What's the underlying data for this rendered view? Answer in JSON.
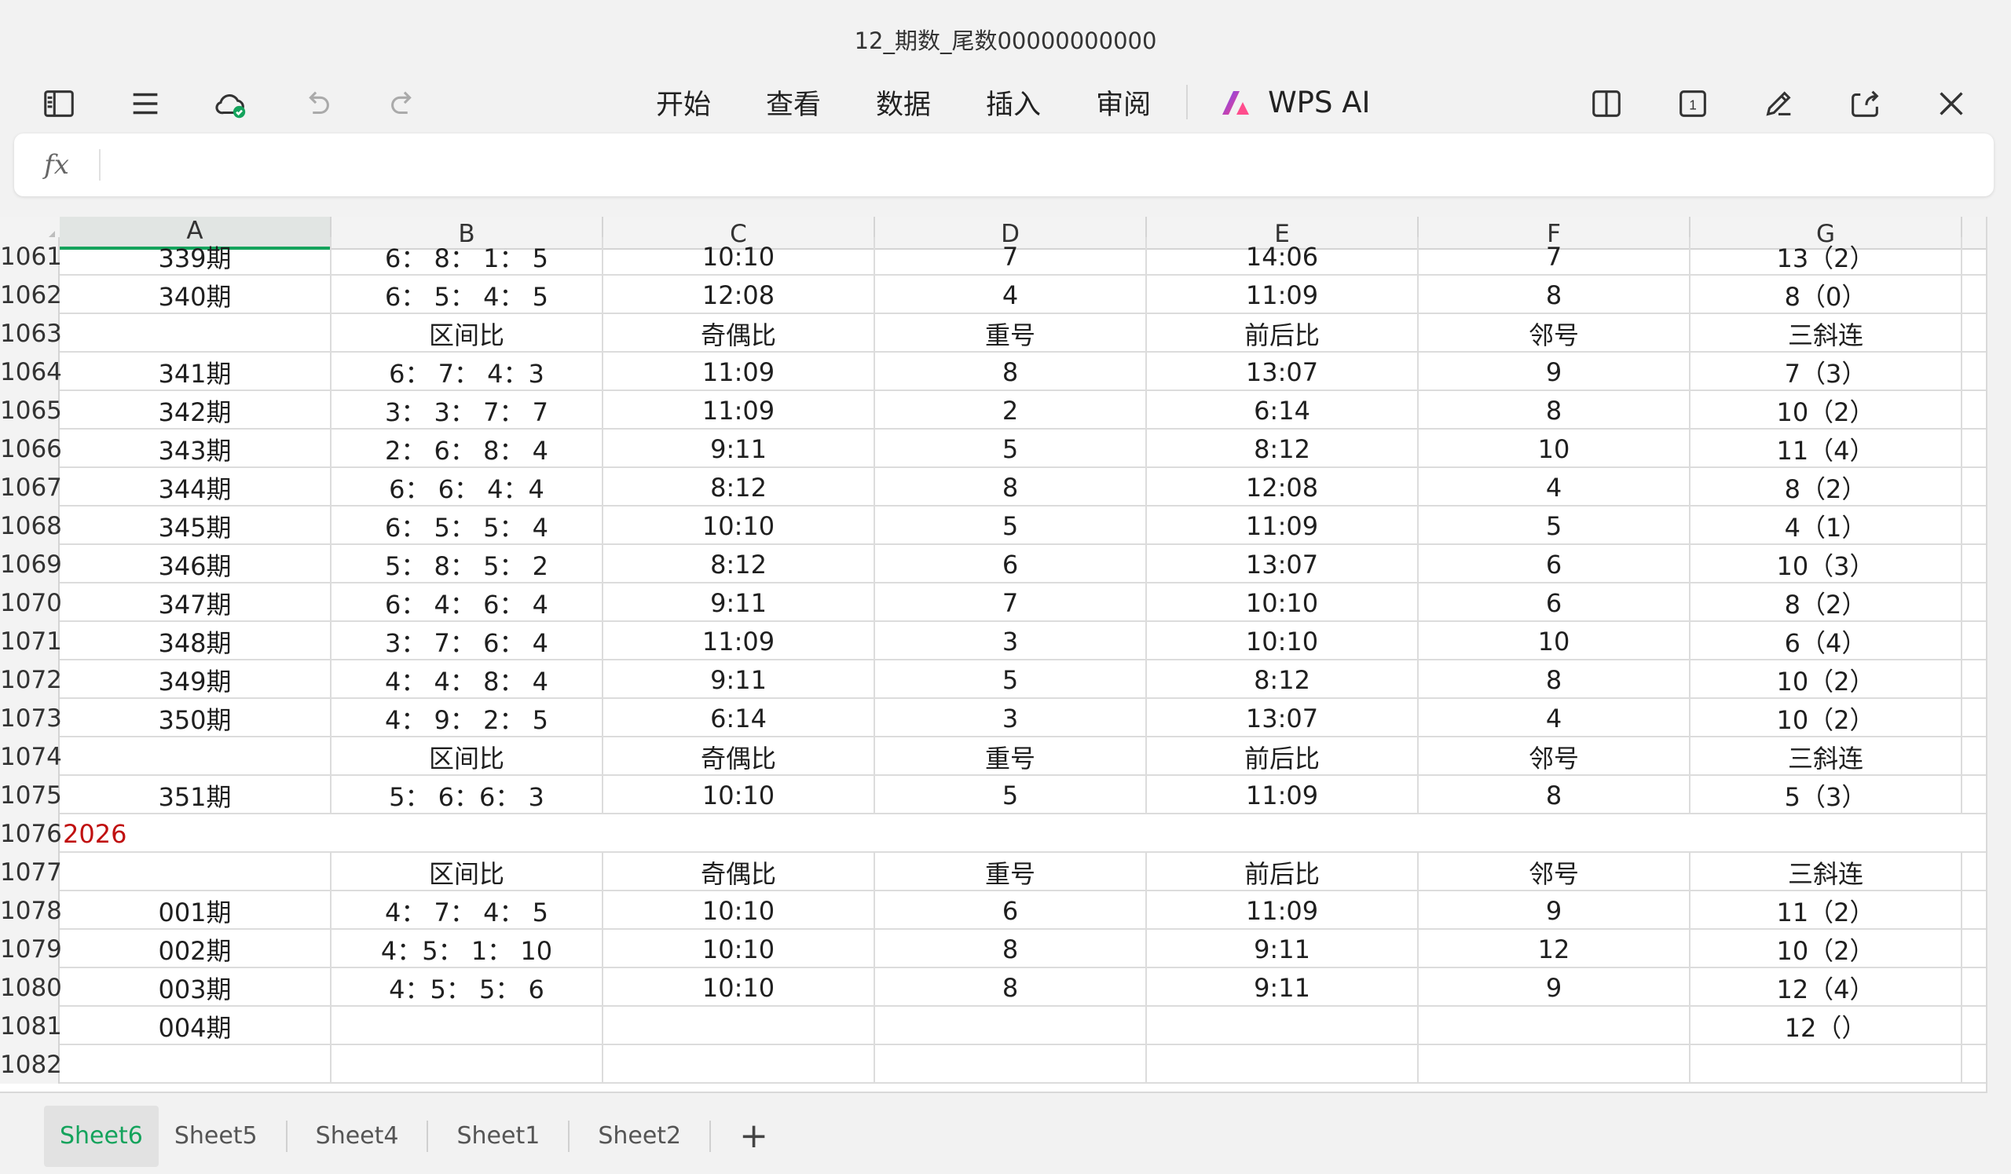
{
  "window": {
    "title": "12_期数_尾数00000000000"
  },
  "toolbar": {
    "menu": [
      "开始",
      "查看",
      "数据",
      "插入",
      "审阅"
    ],
    "ai_label": "WPS AI",
    "page_badge": "1"
  },
  "formula_bar": {
    "fx_label": "fx",
    "value": ""
  },
  "columns": [
    "A",
    "B",
    "C",
    "D",
    "E",
    "F",
    "G"
  ],
  "rows": [
    {
      "n": "1061",
      "cells": [
        "339期",
        "6： 8： 1： 5",
        "10:10",
        "7",
        "14:06",
        "7",
        "13（2）"
      ]
    },
    {
      "n": "1062",
      "cells": [
        "340期",
        "6： 5： 4： 5",
        "12:08",
        "4",
        "11:09",
        "8",
        "8（0）"
      ]
    },
    {
      "n": "1063",
      "cells": [
        "",
        "区间比",
        "奇偶比",
        "重号",
        "前后比",
        "邻号",
        "三斜连"
      ]
    },
    {
      "n": "1064",
      "cells": [
        "341期",
        "6： 7： 4：3",
        "11:09",
        "8",
        "13:07",
        "9",
        "7（3）"
      ]
    },
    {
      "n": "1065",
      "cells": [
        "342期",
        "3： 3： 7： 7",
        "11:09",
        "2",
        "6:14",
        "8",
        "10（2）"
      ]
    },
    {
      "n": "1066",
      "cells": [
        "343期",
        "2： 6： 8： 4",
        "9:11",
        "5",
        "8:12",
        "10",
        "11（4）"
      ]
    },
    {
      "n": "1067",
      "cells": [
        "344期",
        "6： 6： 4：4",
        "8:12",
        "8",
        "12:08",
        "4",
        "8（2）"
      ]
    },
    {
      "n": "1068",
      "cells": [
        "345期",
        "6： 5： 5： 4",
        "10:10",
        "5",
        "11:09",
        "5",
        "4（1）"
      ]
    },
    {
      "n": "1069",
      "cells": [
        "346期",
        "5： 8： 5： 2",
        "8:12",
        "6",
        "13:07",
        "6",
        "10（3）"
      ]
    },
    {
      "n": "1070",
      "cells": [
        "347期",
        "6： 4： 6： 4",
        "9:11",
        "7",
        "10:10",
        "6",
        "8（2）"
      ]
    },
    {
      "n": "1071",
      "cells": [
        "348期",
        "3： 7： 6： 4",
        "11:09",
        "3",
        "10:10",
        "10",
        "6（4）"
      ]
    },
    {
      "n": "1072",
      "cells": [
        "349期",
        "4： 4： 8： 4",
        "9:11",
        "5",
        "8:12",
        "8",
        "10（2）"
      ]
    },
    {
      "n": "1073",
      "cells": [
        "350期",
        "4： 9： 2： 5",
        "6:14",
        "3",
        "13:07",
        "4",
        "10（2）"
      ]
    },
    {
      "n": "1074",
      "cells": [
        "",
        "区间比",
        "奇偶比",
        "重号",
        "前后比",
        "邻号",
        "三斜连"
      ]
    },
    {
      "n": "1075",
      "cells": [
        "351期",
        "5： 6：6： 3",
        "10:10",
        "5",
        "11:09",
        "8",
        "5（3）"
      ]
    },
    {
      "n": "1076",
      "year": "2026",
      "cells": [
        "",
        "",
        "",
        "",
        "",
        "",
        ""
      ]
    },
    {
      "n": "1077",
      "cells": [
        "",
        "区间比",
        "奇偶比",
        "重号",
        "前后比",
        "邻号",
        "三斜连"
      ]
    },
    {
      "n": "1078",
      "cells": [
        "001期",
        "4： 7： 4： 5",
        "10:10",
        "6",
        "11:09",
        "9",
        "11（2）"
      ]
    },
    {
      "n": "1079",
      "cells": [
        "002期",
        "4：5： 1： 10",
        "10:10",
        "8",
        "9:11",
        "12",
        "10（2）"
      ]
    },
    {
      "n": "1080",
      "cells": [
        "003期",
        "4：5： 5： 6",
        "10:10",
        "8",
        "9:11",
        "9",
        "12（4）"
      ]
    },
    {
      "n": "1081",
      "cells": [
        "004期",
        "",
        "",
        "",
        "",
        "",
        "12（）"
      ]
    },
    {
      "n": "1082",
      "cells": [
        "",
        "",
        "",
        "",
        "",
        "",
        ""
      ]
    }
  ],
  "sheet_tabs": [
    "Sheet6",
    "Sheet5",
    "Sheet4",
    "Sheet1",
    "Sheet2"
  ],
  "active_tab": "Sheet6",
  "add_tab_label": "+",
  "colors": {
    "accent": "#14a35c",
    "year_text": "#c01010"
  }
}
